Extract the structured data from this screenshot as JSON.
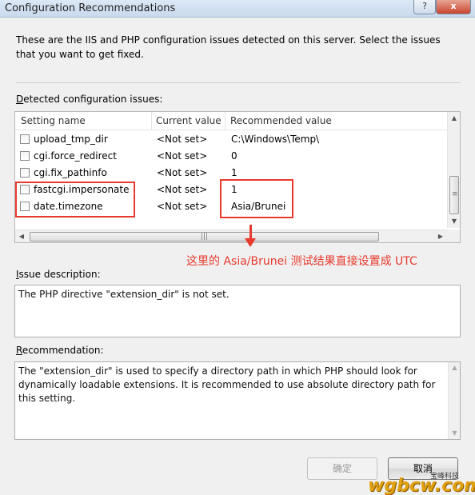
{
  "window": {
    "title": "Configuration Recommendations",
    "help_glyph": "?",
    "close_glyph": "x"
  },
  "intro": "These are the IIS and PHP configuration issues detected on this server. Select the issues that you want to get fixed.",
  "issues": {
    "label_prefix": "D",
    "label_rest": "etected configuration issues:",
    "columns": [
      "Setting name",
      "Current value",
      "Recommended value"
    ],
    "rows": [
      {
        "name": "upload_tmp_dir",
        "current": "<Not set>",
        "recommended": "C:\\Windows\\Temp\\",
        "checked": false
      },
      {
        "name": "cgi.force_redirect",
        "current": "<Not set>",
        "recommended": "0",
        "checked": false
      },
      {
        "name": "cgi.fix_pathinfo",
        "current": "<Not set>",
        "recommended": "1",
        "checked": false
      },
      {
        "name": "fastcgi.impersonate",
        "current": "<Not set>",
        "recommended": "1",
        "checked": false
      },
      {
        "name": "date.timezone",
        "current": "<Not set>",
        "recommended": "Asia/Brunei",
        "checked": false
      }
    ]
  },
  "annotation": "这里的 Asia/Brunei 测试结果直接设置成 UTC",
  "issue_description": {
    "label_prefix": "I",
    "label_rest": "ssue description:",
    "text": "The PHP directive \"extension_dir\" is not set."
  },
  "recommendation": {
    "label_prefix": "R",
    "label_rest": "ecommendation:",
    "text": "The \"extension_dir\" is used to specify a directory path in which PHP should look for dynamically loadable extensions. It is recommended to use absolute directory path for this setting."
  },
  "buttons": {
    "ok": "确定",
    "cancel": "取消"
  },
  "watermark": {
    "small": "宝峰科技",
    "big": "wgbcw.com"
  },
  "colors": {
    "highlight": "#e83a2e",
    "watermark": "#e0a010"
  }
}
